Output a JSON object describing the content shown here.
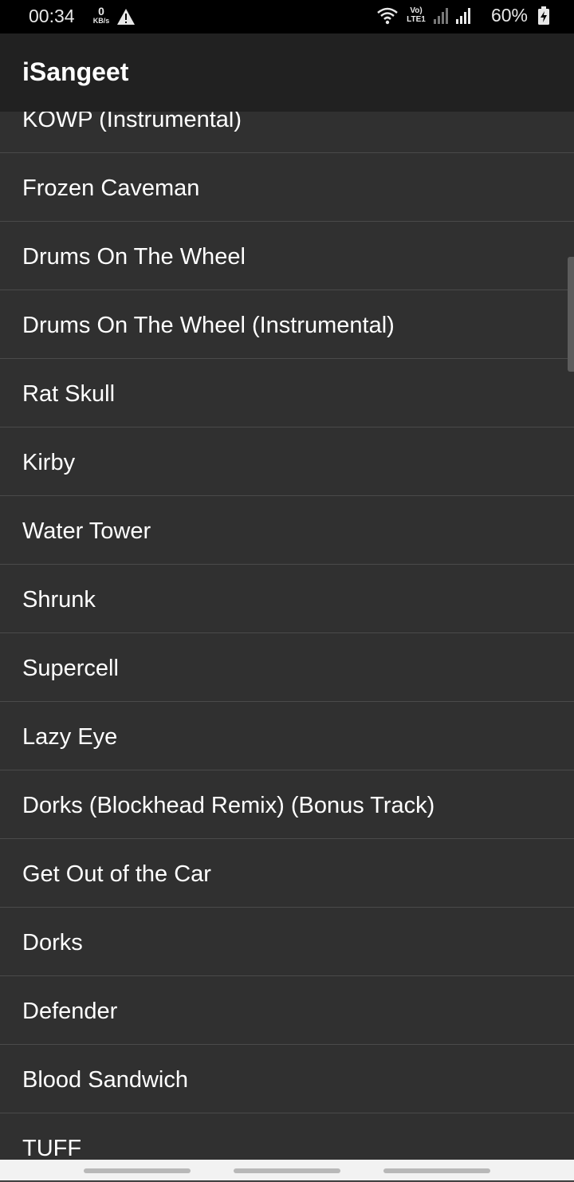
{
  "status_bar": {
    "time": "00:34",
    "data_speed_value": "0",
    "data_speed_unit": "KB/s",
    "network_label": "Vo) LTE1",
    "battery_percent": "60%"
  },
  "app_bar": {
    "title": "iSangeet"
  },
  "songs": [
    "KOWP (Instrumental)",
    "Frozen Caveman",
    "Drums On The Wheel",
    "Drums On The Wheel (Instrumental)",
    "Rat Skull",
    "Kirby",
    "Water Tower",
    "Shrunk",
    "Supercell",
    "Lazy Eye",
    "Dorks (Blockhead Remix) (Bonus Track)",
    "Get Out of the Car",
    "Dorks",
    "Defender",
    "Blood Sandwich",
    "TUFF"
  ],
  "colors": {
    "background": "#303030",
    "app_bar": "#212121",
    "status_bar": "#000000",
    "text": "#ffffff",
    "divider": "#4a4a4a"
  },
  "icons": {
    "warning": "warning-icon",
    "wifi": "wifi-icon",
    "signal": "signal-icon",
    "battery": "battery-charging-icon"
  }
}
